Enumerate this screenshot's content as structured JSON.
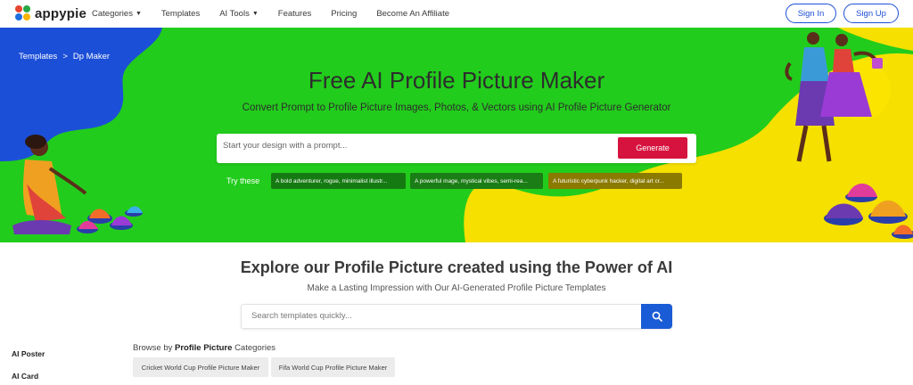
{
  "header": {
    "brand": "appypie",
    "nav": [
      {
        "label": "Categories",
        "dropdown": true
      },
      {
        "label": "Templates",
        "dropdown": false
      },
      {
        "label": "AI Tools",
        "dropdown": true
      },
      {
        "label": "Features",
        "dropdown": false
      },
      {
        "label": "Pricing",
        "dropdown": false
      },
      {
        "label": "Become An Affiliate",
        "dropdown": false
      }
    ],
    "sign_in": "Sign In",
    "sign_up": "Sign Up"
  },
  "breadcrumb": {
    "root": "Templates",
    "separator": ">",
    "current": "Dp Maker"
  },
  "hero": {
    "title": "Free AI Profile Picture Maker",
    "subtitle": "Convert Prompt to Profile Picture Images, Photos, & Vectors using AI Profile Picture Generator",
    "prompt_placeholder": "Start your design with a prompt...",
    "generate_label": "Generate",
    "try_label": "Try these",
    "suggestions": [
      "A bold adventurer, rogue, minimalist illustr...",
      "A powerful mage, mystical vibes, semi-rea...",
      "A futuristic cyberpunk hacker, digital art cr..."
    ]
  },
  "explore": {
    "title": "Explore our Profile Picture created using the Power of AI",
    "subtitle": "Make a Lasting Impression with Our AI-Generated Profile Picture Templates",
    "search_placeholder": "Search templates quickly..."
  },
  "sidebar": {
    "items": [
      "AI Poster",
      "AI Card"
    ]
  },
  "browse": {
    "prefix": "Browse by",
    "highlight": "Profile Picture",
    "suffix": "Categories",
    "categories": [
      "Cricket World Cup Profile Picture Maker",
      "Fifa World Cup Profile Picture Maker"
    ]
  },
  "colors": {
    "hero_green": "#22cc1c",
    "hero_blue": "#1c4fd8",
    "hero_yellow": "#f5e000",
    "generate_red": "#d6133e",
    "brand_blue": "#1d4fd6"
  },
  "icons": {
    "logo": "appypie-logo-icon",
    "search": "search-icon",
    "caret": "caret-down-icon"
  }
}
